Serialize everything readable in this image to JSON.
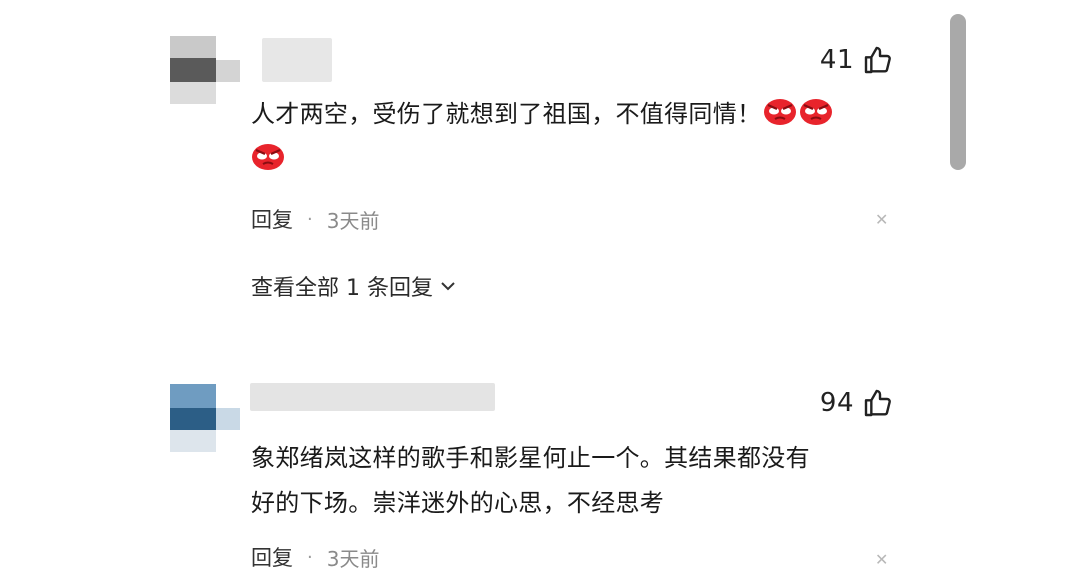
{
  "comments": [
    {
      "likes": "41",
      "text": "人才两空，受伤了就想到了祖国，不值得同情！",
      "emoji_count": 3,
      "reply_label": "回复",
      "separator": "·",
      "time": "3天前",
      "view_replies_label": "查看全部 1 条回复"
    },
    {
      "likes": "94",
      "line1": "象郑绪岚这样的歌手和影星何止一个。其结果都没有",
      "line2": "好的下场。崇洋迷外的心思，不经思考",
      "reply_label": "回复",
      "separator": "·",
      "time": "3天前"
    }
  ],
  "icons": {
    "like": "thumbs-up-icon",
    "emoji": "angry-face-emoji-icon",
    "close": "close-icon",
    "chevron": "chevron-down-icon"
  },
  "colors": {
    "emoji_red": "#e8242c",
    "text": "#1a1a1a",
    "meta_gray": "#8a8a8a",
    "scrollbar": "#a9a9a9"
  }
}
